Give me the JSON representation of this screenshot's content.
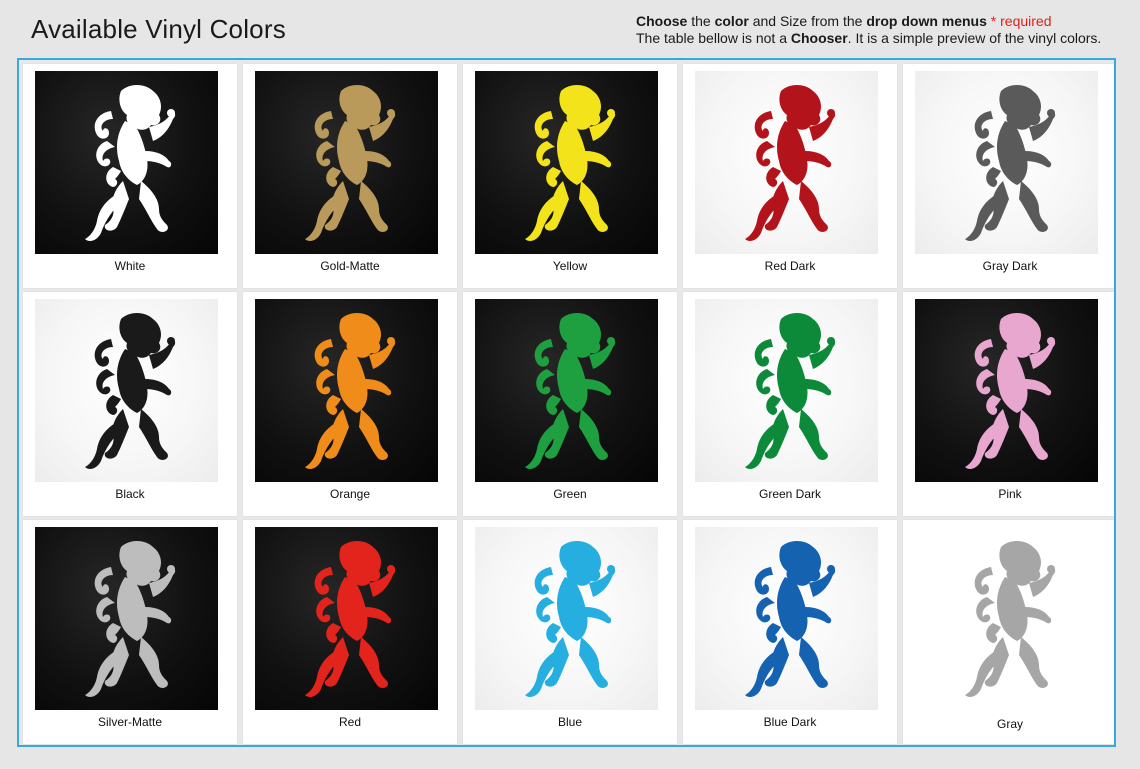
{
  "header": {
    "title": "Available Vinyl Colors",
    "line1_choose": "Choose",
    "line1_the": " the ",
    "line1_color": "color",
    "line1_mid": " and Size from the ",
    "line1_dropdown": "drop down menus",
    "line1_required": " * required",
    "line2_start": "The table bellow is not a ",
    "line2_chooser": "Chooser",
    "line2_end": ". It is a simple preview of the vinyl colors."
  },
  "colors": [
    {
      "name": "White",
      "fill": "#ffffff",
      "background": "dark"
    },
    {
      "name": "Gold-Matte",
      "fill": "#b99a5a",
      "background": "dark"
    },
    {
      "name": "Yellow",
      "fill": "#f3e31a",
      "background": "dark"
    },
    {
      "name": "Red Dark",
      "fill": "#b3141c",
      "background": "light"
    },
    {
      "name": "Gray Dark",
      "fill": "#5a5a5a",
      "background": "light"
    },
    {
      "name": "Black",
      "fill": "#1a1a1a",
      "background": "light"
    },
    {
      "name": "Orange",
      "fill": "#f08c1a",
      "background": "dark"
    },
    {
      "name": "Green",
      "fill": "#1ea040",
      "background": "dark"
    },
    {
      "name": "Green Dark",
      "fill": "#0c8a3a",
      "background": "light"
    },
    {
      "name": "Pink",
      "fill": "#e8a7cf",
      "background": "dark"
    },
    {
      "name": "Silver-Matte",
      "fill": "#bdbdbd",
      "background": "dark"
    },
    {
      "name": "Red",
      "fill": "#e3241d",
      "background": "dark"
    },
    {
      "name": "Blue",
      "fill": "#26aee0",
      "background": "light"
    },
    {
      "name": "Blue Dark",
      "fill": "#1462b0",
      "background": "light"
    },
    {
      "name": "Gray",
      "fill": "#a6a6a6",
      "background": "light"
    }
  ],
  "icons": {
    "swatch": "rampant-lion-icon"
  },
  "accent": {
    "frame_border": "#3aa8e0",
    "required": "#e0201b"
  }
}
